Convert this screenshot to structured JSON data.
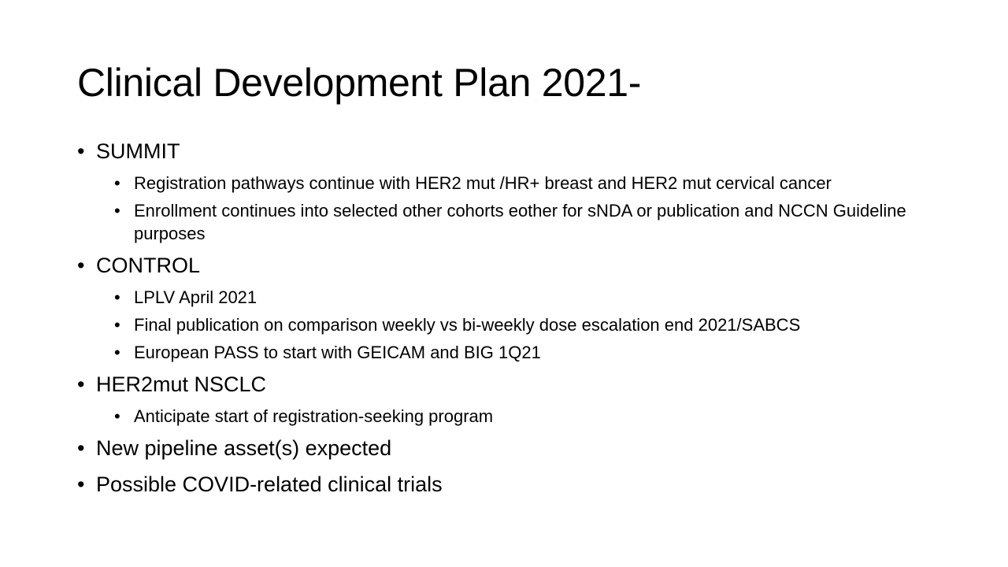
{
  "slide": {
    "title": "Clinical Development Plan 2021-",
    "bullet_char": "•",
    "sections": [
      {
        "label": "SUMMIT",
        "items": [
          "Registration pathways continue with HER2 mut /HR+ breast and HER2 mut cervical cancer",
          "Enrollment continues into selected other cohorts eother for sNDA or publication and NCCN Guideline purposes"
        ]
      },
      {
        "label": "CONTROL",
        "items": [
          "LPLV April 2021",
          "Final publication on comparison weekly vs bi-weekly dose escalation end 2021/SABCS",
          "European PASS to start with GEICAM and BIG 1Q21"
        ]
      },
      {
        "label": "HER2mut NSCLC",
        "items": [
          "Anticipate start of registration-seeking program"
        ]
      },
      {
        "label": "New pipeline asset(s) expected",
        "items": []
      },
      {
        "label": "Possible COVID-related clinical trials",
        "items": []
      }
    ]
  }
}
